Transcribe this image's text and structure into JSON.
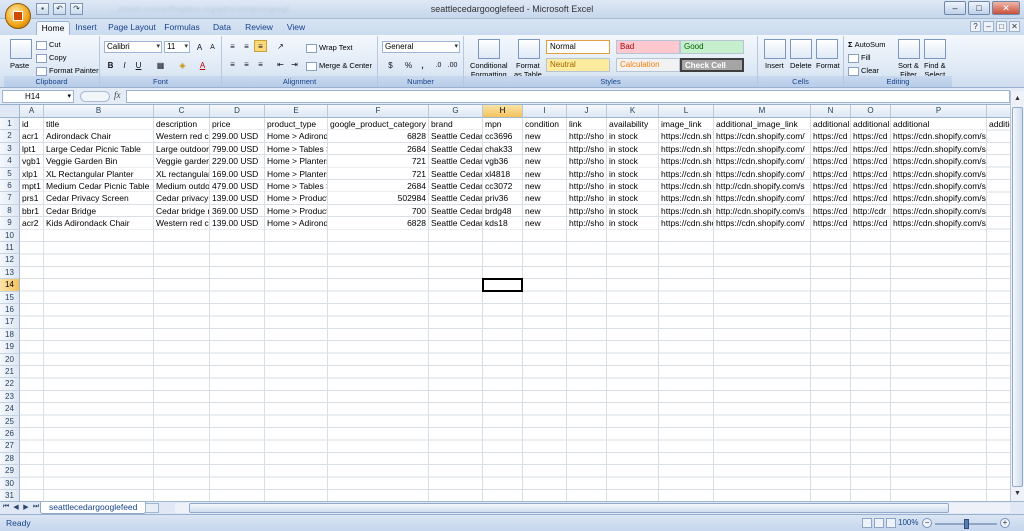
{
  "window": {
    "title": "seattlecedargooglefeed - Microsoft Excel"
  },
  "qat_blur_text": "…cmsdn.com/er/fireplace.org/administration/googl…",
  "tabs": [
    "Home",
    "Insert",
    "Page Layout",
    "Formulas",
    "Data",
    "Review",
    "View"
  ],
  "ribbon": {
    "clipboard": {
      "label": "Clipboard",
      "paste": "Paste",
      "cut": "Cut",
      "copy": "Copy",
      "format_painter": "Format Painter"
    },
    "font": {
      "label": "Font",
      "name": "Calibri",
      "size": "11",
      "bold": "B",
      "italic": "I",
      "underline": "U",
      "grow": "A",
      "shrink": "A",
      "font_color": "A"
    },
    "alignment": {
      "label": "Alignment",
      "wrap": "Wrap Text",
      "merge": "Merge & Center"
    },
    "number": {
      "label": "Number",
      "format": "General",
      "currency": "$",
      "percent": "%",
      "comma": ","
    },
    "styles": {
      "label": "Styles",
      "conditional": "Conditional",
      "conditional2": "Formatting",
      "format_table": "Format",
      "format_table2": "as Table",
      "cells": [
        {
          "name": "Normal",
          "bg": "#ffffff",
          "fg": "#000000"
        },
        {
          "name": "Bad",
          "bg": "#ffc7ce",
          "fg": "#9c0006"
        },
        {
          "name": "Good",
          "bg": "#c6efce",
          "fg": "#006100"
        },
        {
          "name": "Neutral",
          "bg": "#ffeb9c",
          "fg": "#9c6500"
        },
        {
          "name": "Calculation",
          "bg": "#f2f2f2",
          "fg": "#fa7d00"
        },
        {
          "name": "Check Cell",
          "bg": "#a5a5a5",
          "fg": "#ffffff"
        }
      ]
    },
    "cells": {
      "label": "Cells",
      "insert": "Insert",
      "delete": "Delete",
      "format": "Format"
    },
    "editing": {
      "label": "Editing",
      "autosum": "AutoSum",
      "fill": "Fill",
      "clear": "Clear",
      "sort": "Sort &",
      "sort2": "Filter",
      "find": "Find &",
      "find2": "Select"
    }
  },
  "formula_bar": {
    "name_box": "H14",
    "fx": "fx",
    "content": ""
  },
  "columns": [
    "A",
    "B",
    "C",
    "D",
    "E",
    "F",
    "G",
    "H",
    "I",
    "J",
    "K",
    "L",
    "M",
    "N",
    "O",
    "P",
    "Q",
    "R"
  ],
  "selected_column": "H",
  "selected_row": 14,
  "row_numbers": [
    1,
    2,
    3,
    4,
    5,
    6,
    7,
    8,
    9,
    10,
    11,
    12,
    13,
    14,
    15,
    16,
    17,
    18,
    19,
    20,
    21,
    22,
    23,
    24,
    25,
    26,
    27,
    28,
    29,
    30,
    31
  ],
  "rows": [
    [
      "id",
      "title",
      "description",
      "price",
      "product_type",
      "google_product_category",
      "brand",
      "mpn",
      "condition",
      "link",
      "availability",
      "image_link",
      "additional_image_link",
      "additional",
      "additional",
      "additional",
      "additional_image_link",
      ""
    ],
    [
      "acr1",
      "Adirondack Chair",
      "Western red c",
      "299.00 USD",
      "Home > Adirond",
      "6828",
      "Seattle Cedar",
      "cc3696",
      "new",
      "http://sho",
      "in stock",
      "https://cdn.sh",
      "https://cdn.shopify.com/",
      "https://cd",
      "https://cd",
      "https://cdn.shopify.com/s/files-",
      ""
    ],
    [
      "lpt1",
      "Large Cedar Picnic Table",
      "Large outdoor",
      "799.00 USD",
      "Home > Tables >",
      "2684",
      "Seattle Cedar",
      "chak33",
      "new",
      "http://sho",
      "in stock",
      "https://cdn.sh",
      "https://cdn.shopify.com/",
      "https://cd",
      "https://cd",
      "https://cdn.shopify.com/s/files-",
      ""
    ],
    [
      "vgb1",
      "Veggie Garden Bin",
      "Veggie garden",
      "229.00 USD",
      "Home > Planters",
      "721",
      "Seattle Cedar",
      "vgb36",
      "new",
      "http://sho",
      "in stock",
      "https://cdn.sh",
      "https://cdn.shopify.com/",
      "https://cd",
      "https://cd",
      "https://cdn.shopify.com/s/files-",
      ""
    ],
    [
      "xlp1",
      "XL Rectangular Planter",
      "XL rectangular",
      "169.00 USD",
      "Home > Planters",
      "721",
      "Seattle Cedar",
      "xl4818",
      "new",
      "http://sho",
      "in stock",
      "https://cdn.sh",
      "https://cdn.shopify.com/",
      "https://cd",
      "https://cd",
      "https://cdn.shopify.com/s/files-",
      ""
    ],
    [
      "mpt1",
      "Medium Cedar Picnic Table",
      "Medium outdo",
      "479.00 USD",
      "Home > Tables >",
      "2684",
      "Seattle Cedar",
      "cc3072",
      "new",
      "http://sho",
      "in stock",
      "https://cdn.sh",
      "http://cdn.shopify.com/s",
      "https://cd",
      "https://cd",
      "https://cdn.shopify.com/s/files-",
      ""
    ],
    [
      "prs1",
      "Cedar Privacy Screen",
      "Cedar privacy",
      "139.00 USD",
      "Home > Product:",
      "502984",
      "Seattle Cedar",
      "priv36",
      "new",
      "http://sho",
      "in stock",
      "https://cdn.sh",
      "https://cdn.shopify.com/",
      "https://cd",
      "https://cd",
      "https://cdn.shopify.com/s/files-",
      ""
    ],
    [
      "bbr1",
      "Cedar Bridge",
      "Cedar bridge n",
      "369.00 USD",
      "Home > Product:",
      "700",
      "Seattle Cedar",
      "brdg48",
      "new",
      "http://sho",
      "in stock",
      "https://cdn.sh",
      "http://cdn.shopify.com/s",
      "https://cd",
      "http://cdr",
      "https://cdn.shopify.com/s/files-",
      ""
    ],
    [
      "acr2",
      "Kids Adirondack Chair",
      "Western red c",
      "139.00 USD",
      "Home > Adirond",
      "6828",
      "Seattle Cedar",
      "kds18",
      "new",
      "http://sho",
      "in stock",
      "https://cdn.sho",
      "https://cdn.shopify.com/",
      "https://cd",
      "https://cd",
      "https://cdn.shopify.com/s/files-",
      ""
    ]
  ],
  "numeric_columns": [
    5
  ],
  "sheet": {
    "tab": "seattlecedargooglefeed"
  },
  "status": {
    "ready": "Ready",
    "zoom": "100%"
  }
}
